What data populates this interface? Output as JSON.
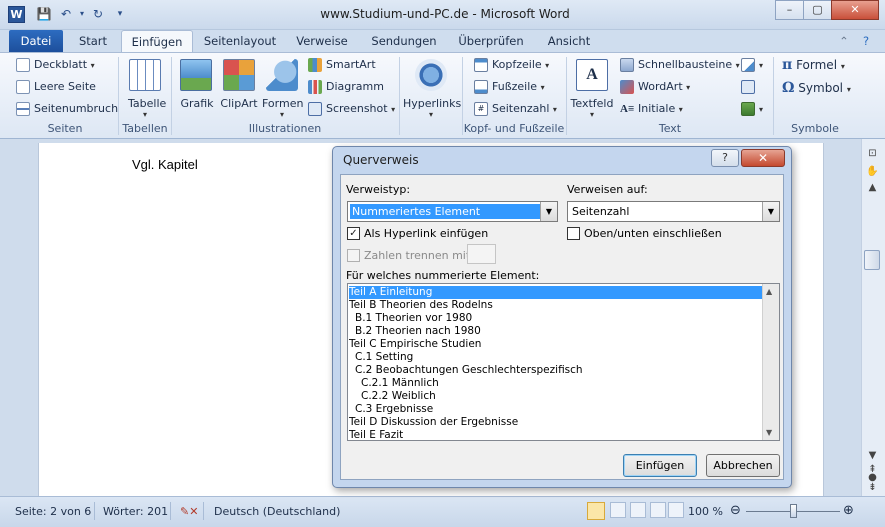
{
  "window": {
    "title": "www.Studium-und-PC.de  -  Microsoft Word",
    "app_icon": "W",
    "controls": {
      "minimize": "–",
      "maximize": "▢",
      "close": "✕"
    }
  },
  "qat": {
    "save_icon": "💾",
    "undo_icon": "↶",
    "redo_icon": "↻",
    "customize_icon": "▾"
  },
  "tabs": [
    {
      "label": "Datei"
    },
    {
      "label": "Start"
    },
    {
      "label": "Einfügen"
    },
    {
      "label": "Seitenlayout"
    },
    {
      "label": "Verweise"
    },
    {
      "label": "Sendungen"
    },
    {
      "label": "Überprüfen"
    },
    {
      "label": "Ansicht"
    }
  ],
  "ribbon": {
    "seiten": {
      "label": "Seiten",
      "items": [
        "Deckblatt",
        "Leere Seite",
        "Seitenumbruch"
      ]
    },
    "tabellen": {
      "label": "Tabellen",
      "button": "Tabelle"
    },
    "illustrationen": {
      "label": "Illustrationen",
      "big": [
        "Grafik",
        "ClipArt",
        "Formen"
      ],
      "small": [
        "SmartArt",
        "Diagramm",
        "Screenshot"
      ]
    },
    "hyperlinks": {
      "label": "",
      "button": "Hyperlinks"
    },
    "kopf": {
      "label": "Kopf- und Fußzeile",
      "items": [
        "Kopfzeile",
        "Fußzeile",
        "Seitenzahl"
      ]
    },
    "text": {
      "label": "Text",
      "big": "Textfeld",
      "items": [
        "Schnellbausteine",
        "WordArt",
        "Initiale"
      ]
    },
    "symbole": {
      "label": "Symbole",
      "items": [
        "Formel",
        "Symbol"
      ]
    }
  },
  "document": {
    "text": "Vgl. Kapitel"
  },
  "dialog": {
    "title": "Querverweis",
    "help": "?",
    "close": "✕",
    "type_label": "Verweistyp:",
    "type_value": "Nummeriertes Element",
    "ref_label": "Verweisen auf:",
    "ref_value": "Seitenzahl",
    "hyperlink_label": "Als Hyperlink einfügen",
    "hyperlink_checked": "✓",
    "above_below_label": "Oben/unten einschließen",
    "separate_label": "Zahlen trennen mit",
    "list_label": "Für welches nummerierte Element:",
    "items": [
      "Teil A Einleitung",
      "Teil B Theorien des Rodelns",
      "  B.1 Theorien vor 1980",
      "  B.2 Theorien nach 1980",
      "Teil C Empirische Studien",
      "  C.1 Setting",
      "  C.2 Beobachtungen Geschlechterspezifisch",
      "    C.2.1 Männlich",
      "    C.2.2 Weiblich",
      "  C.3 Ergebnisse",
      "Teil D Diskussion der Ergebnisse",
      "Teil E Fazit"
    ],
    "insert_button": "Einfügen",
    "cancel_button": "Abbrechen"
  },
  "status": {
    "page": "Seite: 2 von 6",
    "words": "Wörter: 201",
    "language": "Deutsch (Deutschland)",
    "zoom": "100 %",
    "zoom_level": 1.0
  }
}
